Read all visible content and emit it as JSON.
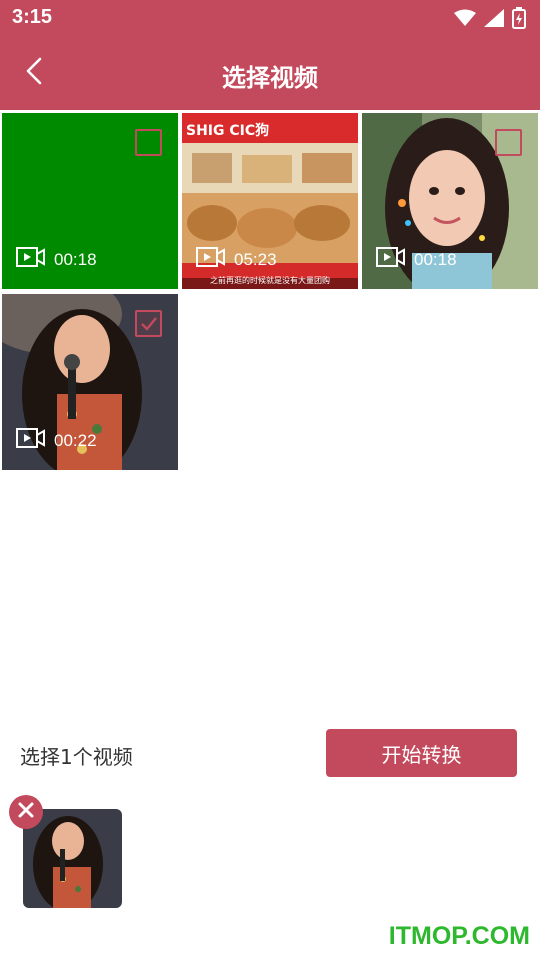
{
  "status_bar": {
    "time": "3:15",
    "icons": [
      "wifi-icon",
      "signal-icon",
      "battery-charging-icon"
    ]
  },
  "header": {
    "title": "选择视频",
    "back_icon": "chevron-left-icon"
  },
  "videos": [
    {
      "duration": "00:18",
      "checked": false,
      "thumbnail": "solid green"
    },
    {
      "duration": "05:23",
      "checked": false,
      "thumbnail": "market scene",
      "caption": "之前再逛的时候就是没有大量团购"
    },
    {
      "duration": "00:18",
      "checked": false,
      "thumbnail": "portrait girl"
    },
    {
      "duration": "00:22",
      "checked": true,
      "thumbnail": "girl with microphone"
    }
  ],
  "footer": {
    "selected_text": "选择1个视频",
    "start_button": "开始转换"
  },
  "selected_items": [
    {
      "thumbnail": "girl with microphone",
      "remove_icon": "close-icon"
    }
  ],
  "watermark": "ITMOP.COM",
  "colors": {
    "brand": "#c3495c",
    "green_tile": "#008a00",
    "watermark": "#2eb82e"
  }
}
